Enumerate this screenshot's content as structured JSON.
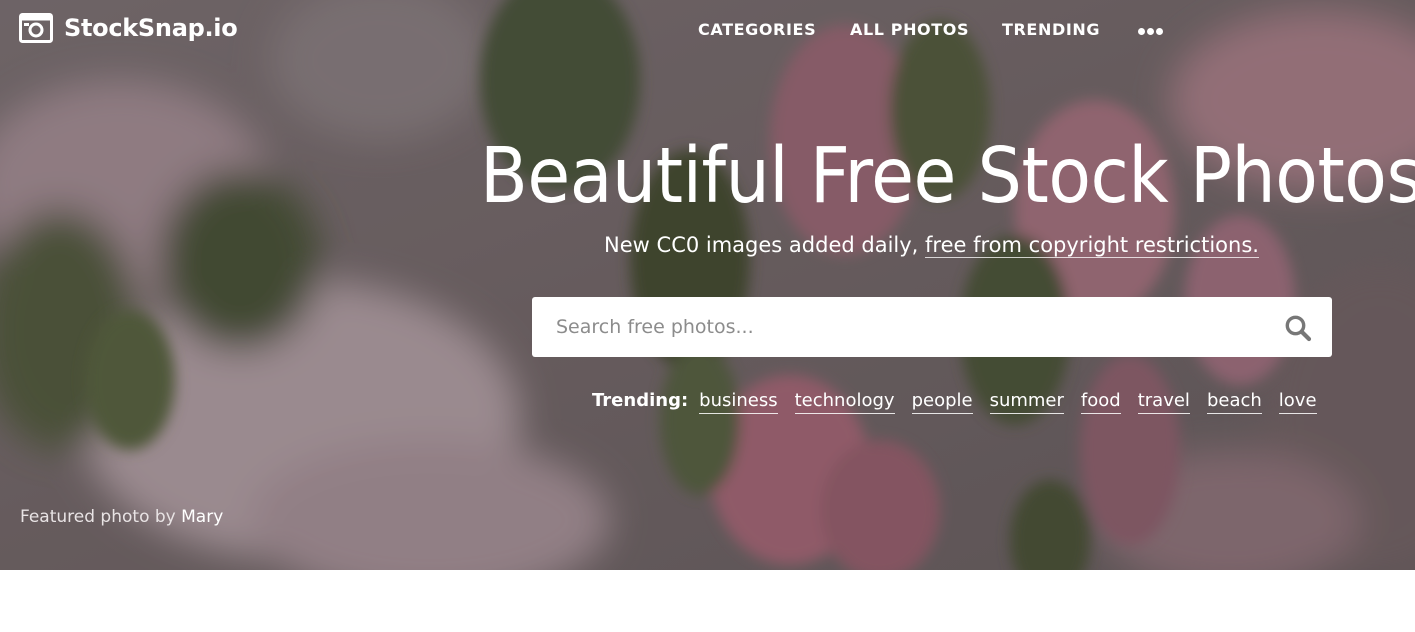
{
  "brand": {
    "name": "StockSnap.io",
    "icon": "camera-icon"
  },
  "nav": {
    "items": [
      "CATEGORIES",
      "ALL PHOTOS",
      "TRENDING"
    ],
    "more_icon": "more-dots-icon"
  },
  "hero": {
    "title": "Beautiful Free Stock Photos",
    "subtitle_text": "New CC0 images added daily,",
    "subtitle_link": "free from copyright restrictions."
  },
  "search": {
    "placeholder": "Search free photos...",
    "value": "",
    "icon": "search-icon"
  },
  "trending": {
    "label": "Trending:",
    "tags": [
      "business",
      "technology",
      "people",
      "summer",
      "food",
      "travel",
      "beach",
      "love"
    ]
  },
  "credit": {
    "text": "Featured photo by",
    "author": "Mary"
  },
  "colors": {
    "hero_overlay": "#6f6566",
    "text": "#ffffff",
    "search_icon": "#777777"
  }
}
